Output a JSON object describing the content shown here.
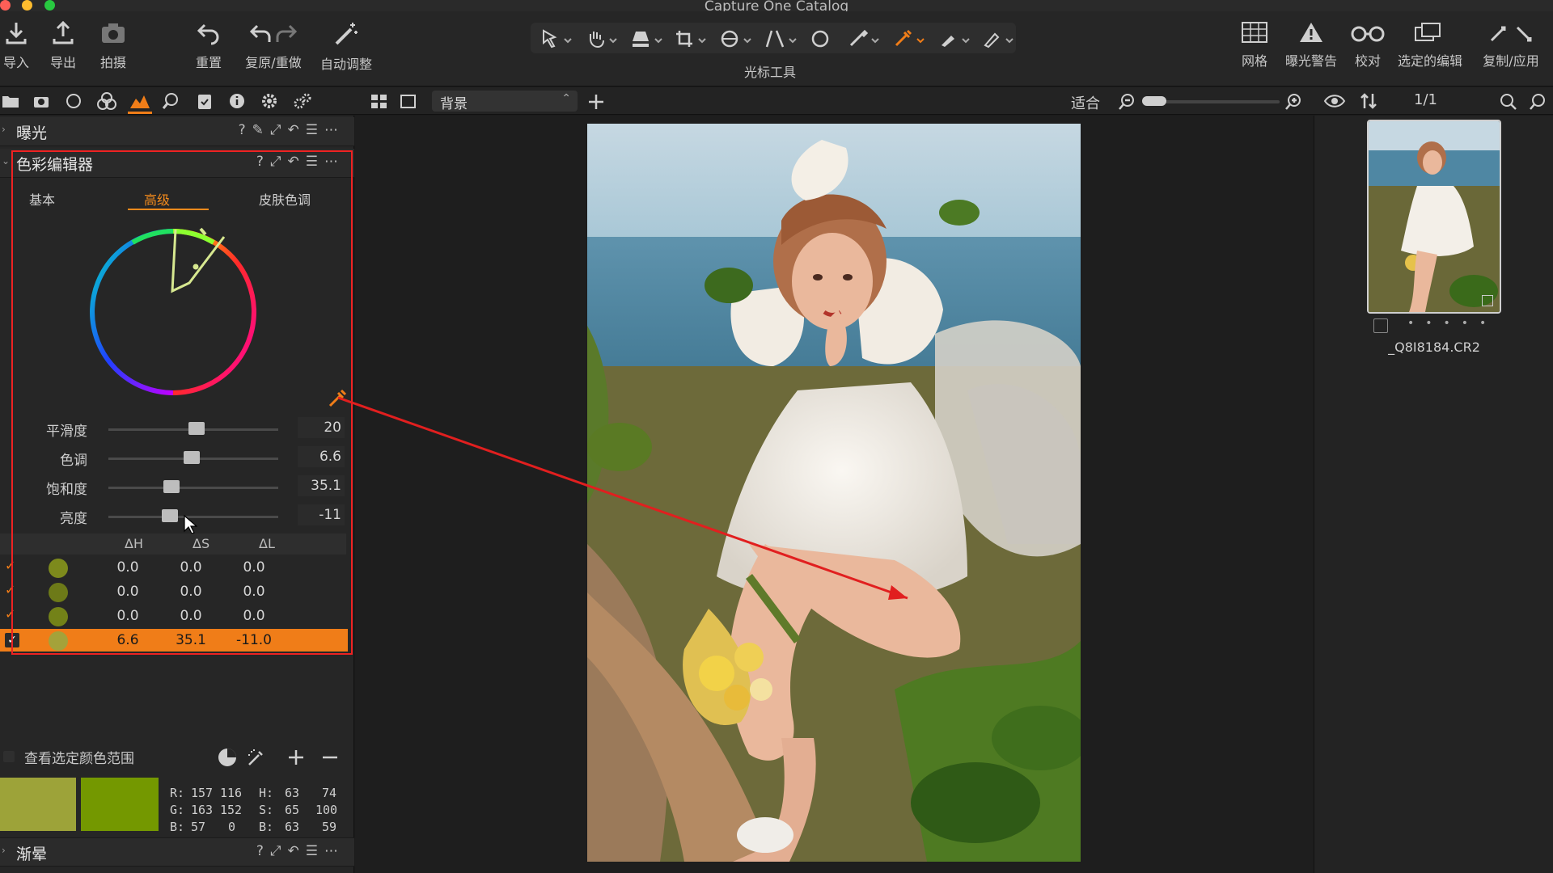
{
  "window": {
    "title": "Capture One Catalog"
  },
  "toolbar": {
    "import": "导入",
    "export": "导出",
    "capture": "拍摄",
    "reset": "重置",
    "undo_redo": "复原/重做",
    "auto_adjust": "自动调整",
    "cursor_tools": "光标工具",
    "grid": "网格",
    "exposure_warning": "曝光警告",
    "proof": "校对",
    "edit_selected": "选定的编辑",
    "copy_apply": "复制/应用"
  },
  "subbar": {
    "layer_select": "背景",
    "fit": "适合",
    "page_count": "1/1"
  },
  "exposure_section": {
    "title": "曝光"
  },
  "color_editor": {
    "title": "色彩编辑器",
    "tabs": [
      "基本",
      "高级",
      "皮肤色调"
    ],
    "active_tab": "高级",
    "sliders": [
      {
        "label": "平滑度",
        "value": "20",
        "fraction": 0.52
      },
      {
        "label": "色调",
        "value": "6.6",
        "fraction": 0.49
      },
      {
        "label": "饱和度",
        "value": "35.1",
        "fraction": 0.37
      },
      {
        "label": "亮度",
        "value": "-11",
        "fraction": 0.36
      }
    ],
    "table_headers": [
      "ΔH",
      "ΔS",
      "ΔL"
    ],
    "rows": [
      {
        "color": "#7d8a1c",
        "dh": "0.0",
        "ds": "0.0",
        "dl": "0.0",
        "selected": false
      },
      {
        "color": "#6d7a18",
        "dh": "0.0",
        "ds": "0.0",
        "dl": "0.0",
        "selected": false
      },
      {
        "color": "#738218",
        "dh": "0.0",
        "ds": "0.0",
        "dl": "0.0",
        "selected": false
      },
      {
        "color": "#a4a23a",
        "dh": "6.6",
        "ds": "35.1",
        "dl": "-11.0",
        "selected": true
      }
    ]
  },
  "color_range": {
    "view_label": "查看选定颜色范围",
    "swatch_before": "#9da339",
    "swatch_after": "#749800",
    "readout": {
      "r_label": "R:",
      "r1": "157",
      "r2": "116",
      "g_label": "G:",
      "g1": "163",
      "g2": "152",
      "b_label": "B:",
      "b1": "57",
      "b2": "0",
      "h_label": "H:",
      "h1": "63",
      "h2": "74",
      "s_label": "S:",
      "s1": "65",
      "s2": "100",
      "bb_label": "B:",
      "bb1": "63",
      "bb2": "59"
    }
  },
  "gradient_section": {
    "title": "渐晕"
  },
  "browser": {
    "filename": "_Q8I8184.CR2"
  },
  "colors": {
    "accent": "#f07d18",
    "highlight_frame": "#e22222"
  }
}
